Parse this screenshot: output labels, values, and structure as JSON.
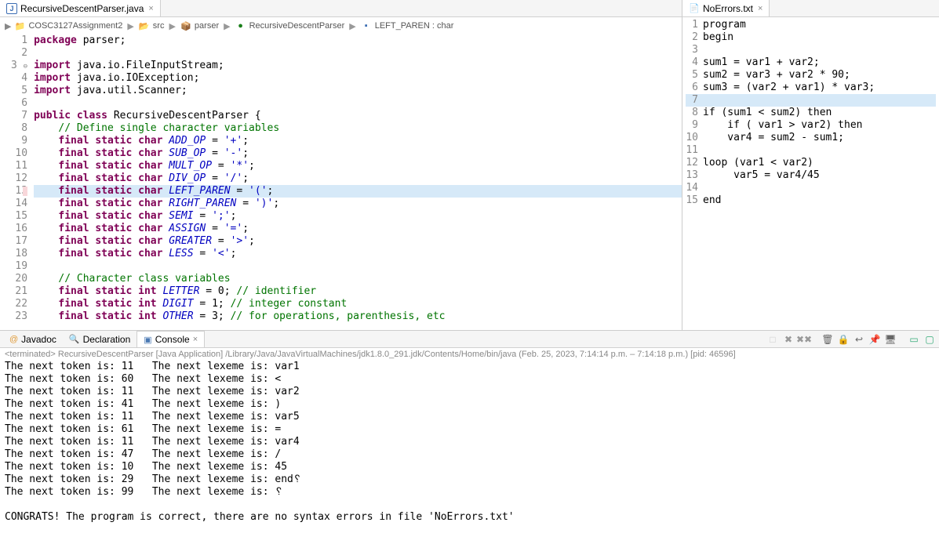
{
  "leftTab": {
    "title": "RecursiveDescentParser.java"
  },
  "rightTab": {
    "title": "NoErrors.txt"
  },
  "breadcrumb": {
    "project": "COSC3127Assignment2",
    "folder1": "src",
    "folder2": "parser",
    "class": "RecursiveDescentParser",
    "member": "LEFT_PAREN : char"
  },
  "views": {
    "javadoc": "Javadoc",
    "declaration": "Declaration",
    "console": "Console"
  },
  "consoleHeader": "<terminated> RecursiveDescentParser [Java Application] /Library/Java/JavaVirtualMachines/jdk1.8.0_291.jdk/Contents/Home/bin/java  (Feb. 25, 2023, 7:14:14 p.m. – 7:14:18 p.m.)  [pid: 46596]",
  "code": {
    "lines": [
      {
        "n": 1,
        "html": "<span class='kw'>package</span> parser;"
      },
      {
        "n": 2,
        "html": ""
      },
      {
        "n": 3,
        "html": "<span class='kw'>import</span> java.io.FileInputStream;",
        "fold": true
      },
      {
        "n": 4,
        "html": "<span class='kw'>import</span> java.io.IOException;"
      },
      {
        "n": 5,
        "html": "<span class='kw'>import</span> java.util.Scanner;"
      },
      {
        "n": 6,
        "html": ""
      },
      {
        "n": 7,
        "html": "<span class='kw'>public class</span> RecursiveDescentParser {"
      },
      {
        "n": 8,
        "html": "    <span class='com'>// Define single character variables</span>"
      },
      {
        "n": 9,
        "html": "    <span class='kw'>final static char</span> <span class='fld'>ADD_OP</span> = <span class='str'>'+'</span>;"
      },
      {
        "n": 10,
        "html": "    <span class='kw'>final static char</span> <span class='fld'>SUB_OP</span> = <span class='str'>'-'</span>;"
      },
      {
        "n": 11,
        "html": "    <span class='kw'>final static char</span> <span class='fld'>MULT_OP</span> = <span class='str'>'*'</span>;"
      },
      {
        "n": 12,
        "html": "    <span class='kw'>final static char</span> <span class='fld'>DIV_OP</span> = <span class='str'>'/'</span>;"
      },
      {
        "n": 13,
        "html": "    <span class='kw'>final static char</span> <span class='fld'>LEFT_PAREN</span> = <span class='str'>'('</span>;",
        "hl": true,
        "err": true
      },
      {
        "n": 14,
        "html": "    <span class='kw'>final static char</span> <span class='fld'>RIGHT_PAREN</span> = <span class='str'>')'</span>;"
      },
      {
        "n": 15,
        "html": "    <span class='kw'>final static char</span> <span class='fld'>SEMI</span> = <span class='str'>';'</span>;"
      },
      {
        "n": 16,
        "html": "    <span class='kw'>final static char</span> <span class='fld'>ASSIGN</span> = <span class='str'>'='</span>;"
      },
      {
        "n": 17,
        "html": "    <span class='kw'>final static char</span> <span class='fld'>GREATER</span> = <span class='str'>'&gt;'</span>;"
      },
      {
        "n": 18,
        "html": "    <span class='kw'>final static char</span> <span class='fld'>LESS</span> = <span class='str'>'&lt;'</span>;"
      },
      {
        "n": 19,
        "html": ""
      },
      {
        "n": 20,
        "html": "    <span class='com'>// Character class variables</span>"
      },
      {
        "n": 21,
        "html": "    <span class='kw'>final static int</span> <span class='fld'>LETTER</span> = 0; <span class='com'>// identifier</span>"
      },
      {
        "n": 22,
        "html": "    <span class='kw'>final static int</span> <span class='fld'>DIGIT</span> = 1; <span class='com'>// integer constant</span>"
      },
      {
        "n": 23,
        "html": "    <span class='kw'>final static int</span> <span class='fld'>OTHER</span> = 3; <span class='com'>// for operations, parenthesis, etc</span>"
      }
    ]
  },
  "rightFile": {
    "lines": [
      {
        "n": 1,
        "t": "program"
      },
      {
        "n": 2,
        "t": "begin"
      },
      {
        "n": 3,
        "t": ""
      },
      {
        "n": 4,
        "t": "sum1 = var1 + var2;"
      },
      {
        "n": 5,
        "t": "sum2 = var3 + var2 * 90;"
      },
      {
        "n": 6,
        "t": "sum3 = (var2 + var1) * var3;"
      },
      {
        "n": 7,
        "t": "",
        "hl": true
      },
      {
        "n": 8,
        "t": "if (sum1 < sum2) then"
      },
      {
        "n": 9,
        "t": "    if ( var1 > var2) then"
      },
      {
        "n": 10,
        "t": "    var4 = sum2 - sum1;"
      },
      {
        "n": 11,
        "t": ""
      },
      {
        "n": 12,
        "t": "loop (var1 < var2)"
      },
      {
        "n": 13,
        "t": "     var5 = var4/45"
      },
      {
        "n": 14,
        "t": ""
      },
      {
        "n": 15,
        "t": "end"
      }
    ]
  },
  "console": {
    "lines": [
      "The next token is: 11   The next lexeme is: var1",
      "The next token is: 60   The next lexeme is: <",
      "The next token is: 11   The next lexeme is: var2",
      "The next token is: 41   The next lexeme is: )",
      "The next token is: 11   The next lexeme is: var5",
      "The next token is: 61   The next lexeme is: =",
      "The next token is: 11   The next lexeme is: var4",
      "The next token is: 47   The next lexeme is: /",
      "The next token is: 10   The next lexeme is: 45",
      "The next token is: 29   The next lexeme is: end␦",
      "The next token is: 99   The next lexeme is: ␦",
      "",
      "CONGRATS! The program is correct, there are no syntax errors in file 'NoErrors.txt'"
    ]
  }
}
